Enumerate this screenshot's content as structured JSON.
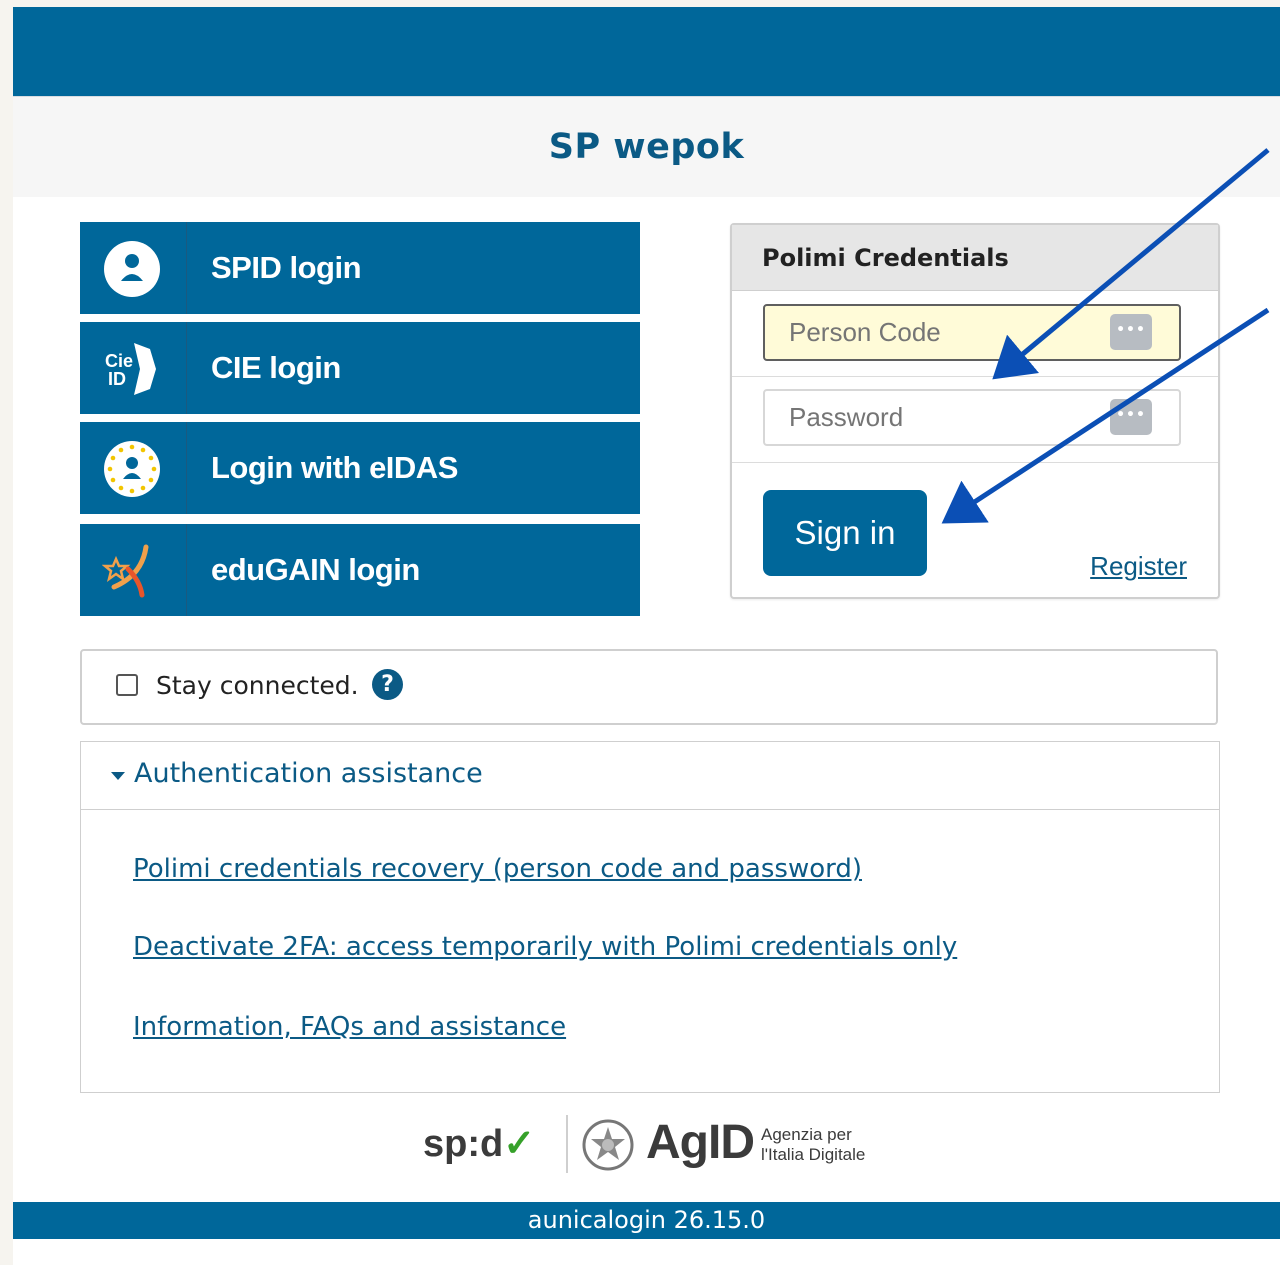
{
  "service": {
    "title": "SP wepok"
  },
  "login_options": [
    {
      "label": "SPID login",
      "icon": "spid-user-icon"
    },
    {
      "label": "CIE login",
      "icon": "cie-id-icon"
    },
    {
      "label": "Login with eIDAS",
      "icon": "eidas-user-icon"
    },
    {
      "label": "eduGAIN login",
      "icon": "edugain-star-icon"
    }
  ],
  "credentials": {
    "heading": "Polimi Credentials",
    "person_code_placeholder": "Person Code",
    "password_placeholder": "Password",
    "sign_in_label": "Sign in",
    "register_label": "Register",
    "password_manager_icon": "key-dots-icon"
  },
  "stay_connected": {
    "label": "Stay connected.",
    "help": "?",
    "checked": false
  },
  "assistance": {
    "heading": "Authentication assistance",
    "links": [
      "Polimi credentials recovery (person code and password)",
      "Deactivate 2FA: access temporarily with Polimi credentials only",
      "Information, FAQs and assistance"
    ]
  },
  "logos": {
    "spid_text": "sp:d",
    "agid_text": "AgID",
    "agid_sub_line1": "Agenzia per",
    "agid_sub_line2": "l'Italia Digitale"
  },
  "footer": {
    "version": "aunicalogin 26.15.0"
  },
  "colors": {
    "brand_blue": "#00679a",
    "link_blue": "#0b5a85",
    "annotation_arrow": "#0b4fb5"
  }
}
